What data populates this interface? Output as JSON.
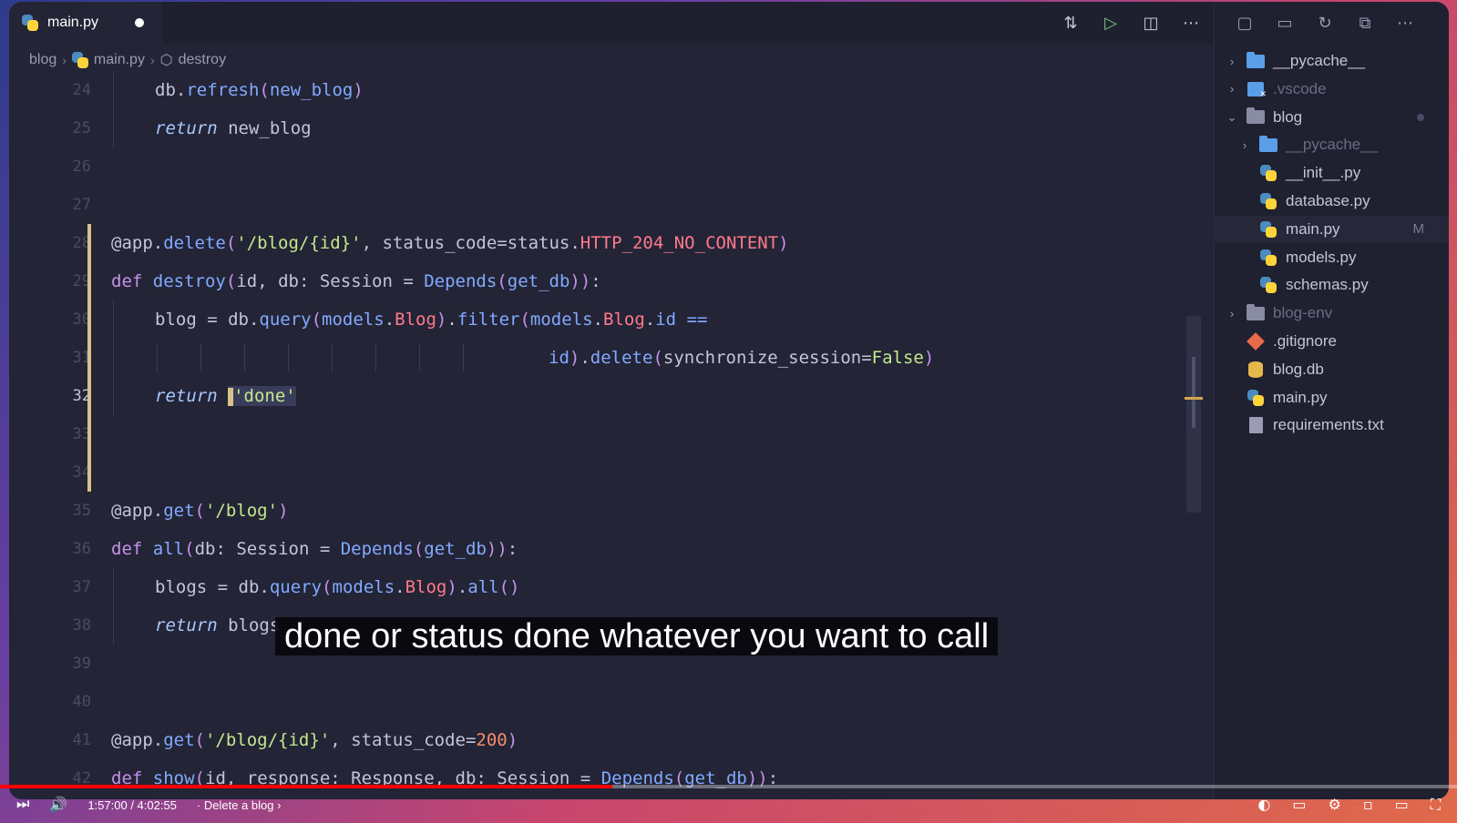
{
  "tab": {
    "label": "main.py",
    "modified": true
  },
  "breadcrumb": {
    "items": [
      "blog",
      "main.py",
      "destroy"
    ]
  },
  "code": {
    "lines": [
      {
        "n": "24",
        "html": "<span class=\"dec\">db.</span><span class=\"fn\">refresh</span><span class=\"kw\">(</span><span class=\"fn\">new_blog</span><span class=\"kw\">)</span>",
        "indent": 1
      },
      {
        "n": "25",
        "html": "<span class=\"it\">return</span> new_blog",
        "indent": 1
      },
      {
        "n": "26",
        "html": "",
        "indent": 0
      },
      {
        "n": "27",
        "html": "",
        "indent": 0
      },
      {
        "n": "28",
        "html": "<span class=\"dec\">@app.</span><span class=\"fn\">delete</span><span class=\"kw\">(</span><span class=\"str\">'/blog/{id}'</span>, status_code=status.<span class=\"const\">HTTP_204_NO_CONTENT</span><span class=\"kw\">)</span>",
        "indent": 0
      },
      {
        "n": "29",
        "html": "<span class=\"kw\">def</span> <span class=\"fn\">destroy</span><span class=\"kw\">(</span>id, db: Session = <span class=\"fn\">Depends</span><span class=\"kw\">(</span><span class=\"fn\">get_db</span><span class=\"kw\">))</span>:",
        "indent": 0
      },
      {
        "n": "30",
        "html": "blog = db.<span class=\"fn\">query</span><span class=\"kw\">(</span><span class=\"fn\">models</span>.<span class=\"const\">Blog</span><span class=\"kw\">)</span>.<span class=\"fn\">filter</span><span class=\"kw\">(</span><span class=\"fn\">models</span>.<span class=\"const\">Blog</span>.<span class=\"fn\">id</span> <span class=\"fn\">==</span>",
        "indent": 1
      },
      {
        "n": "31",
        "html": "<span class=\"fn\">id</span><span class=\"kw\">)</span>.<span class=\"fn\">delete</span><span class=\"kw\">(</span>synchronize_session=<span class=\"str\">False</span><span class=\"kw\">)</span>",
        "indent": 10
      },
      {
        "n": "32",
        "html": "<span class=\"it\">return</span> <span class=\"sel\"><span class=\"cursor-box\"></span><span class=\"str\">'done'</span></span>",
        "indent": 1,
        "active": true
      },
      {
        "n": "33",
        "html": "",
        "indent": 0
      },
      {
        "n": "34",
        "html": "",
        "indent": 0
      },
      {
        "n": "35",
        "html": "<span class=\"dec\">@app.</span><span class=\"fn\">get</span><span class=\"kw\">(</span><span class=\"str\">'/blog'</span><span class=\"kw\">)</span>",
        "indent": 0
      },
      {
        "n": "36",
        "html": "<span class=\"kw\">def</span> <span class=\"fn\">all</span><span class=\"kw\">(</span>db: Session = <span class=\"fn\">Depends</span><span class=\"kw\">(</span><span class=\"fn\">get_db</span><span class=\"kw\">))</span>:",
        "indent": 0
      },
      {
        "n": "37",
        "html": "blogs = db.<span class=\"fn\">query</span><span class=\"kw\">(</span><span class=\"fn\">models</span>.<span class=\"const\">Blog</span><span class=\"kw\">)</span>.<span class=\"fn\">all</span><span class=\"kw\">()</span>",
        "indent": 1
      },
      {
        "n": "38",
        "html": "<span class=\"it\">return</span> blogs",
        "indent": 1
      },
      {
        "n": "39",
        "html": "",
        "indent": 0
      },
      {
        "n": "40",
        "html": "",
        "indent": 0
      },
      {
        "n": "41",
        "html": "<span class=\"dec\">@app.</span><span class=\"fn\">get</span><span class=\"kw\">(</span><span class=\"str\">'/blog/{id}'</span>, status_code=<span class=\"num\">200</span><span class=\"kw\">)</span>",
        "indent": 0
      },
      {
        "n": "42",
        "html": "<span class=\"kw\">def</span> <span class=\"fn\">show</span><span class=\"kw\">(</span>id, response: Response, db: Session = <span class=\"fn\">Depends</span><span class=\"kw\">(</span><span class=\"fn\">get_db</span><span class=\"kw\">))</span>:",
        "indent": 0
      }
    ]
  },
  "explorer": {
    "items": [
      {
        "name": "__pycache__",
        "type": "folder",
        "level": 0,
        "chev": "›"
      },
      {
        "name": ".vscode",
        "type": "vscode",
        "level": 0,
        "chev": "›",
        "dim": true
      },
      {
        "name": "blog",
        "type": "folder-open",
        "level": 0,
        "chev": "⌄",
        "dot": true
      },
      {
        "name": "__pycache__",
        "type": "folder",
        "level": 1,
        "chev": "›",
        "dim": true
      },
      {
        "name": "__init__.py",
        "type": "py",
        "level": 1
      },
      {
        "name": "database.py",
        "type": "py",
        "level": 1
      },
      {
        "name": "main.py",
        "type": "py",
        "level": 1,
        "badge": "M",
        "active": true
      },
      {
        "name": "models.py",
        "type": "py",
        "level": 1
      },
      {
        "name": "schemas.py",
        "type": "py",
        "level": 1
      },
      {
        "name": "blog-env",
        "type": "folder-gray",
        "level": 0,
        "chev": "›",
        "dim": true
      },
      {
        "name": ".gitignore",
        "type": "git",
        "level": 0
      },
      {
        "name": "blog.db",
        "type": "db",
        "level": 0
      },
      {
        "name": "main.py",
        "type": "py",
        "level": 0
      },
      {
        "name": "requirements.txt",
        "type": "txt",
        "level": 0
      }
    ]
  },
  "caption": {
    "text": "done or status done whatever you want to call"
  },
  "player": {
    "time": "1:57:00 / 4:02:55",
    "chapter": "· Delete a blog ›",
    "progress": 0.42
  }
}
